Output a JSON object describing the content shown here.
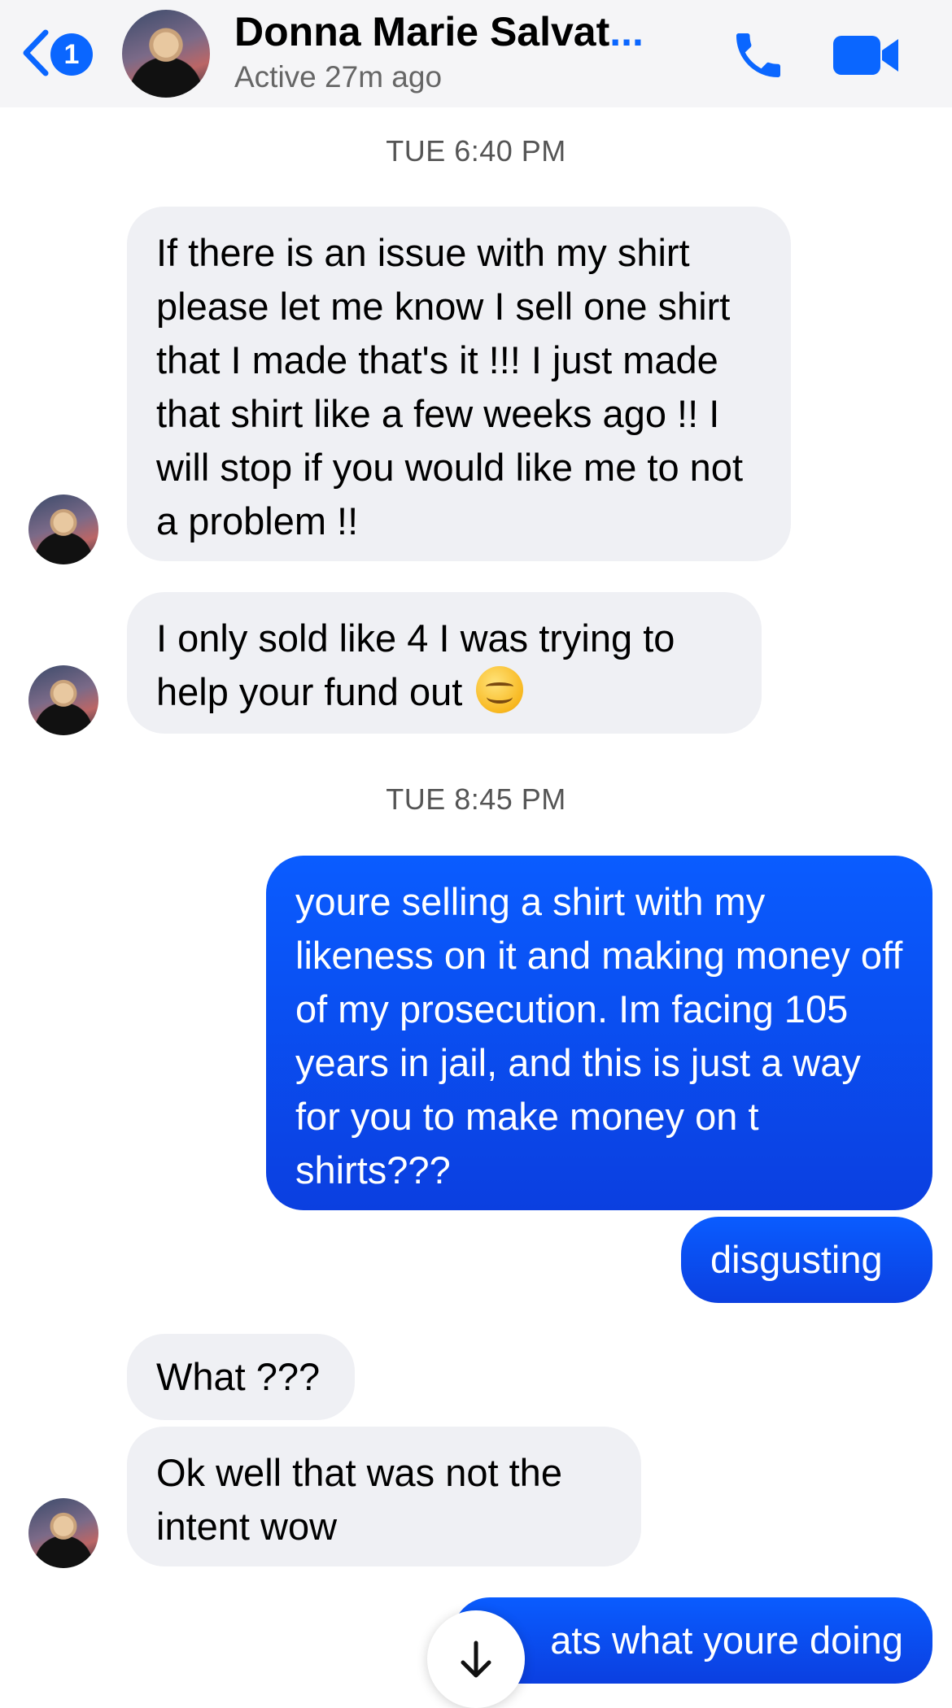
{
  "header": {
    "back_badge": "1",
    "contact_name": "Donna Marie Salvat",
    "name_truncation": "...",
    "status": "Active 27m ago",
    "icons": [
      "back-chevron-icon",
      "phone-icon",
      "video-camera-icon"
    ],
    "accent": "#0a66ff"
  },
  "thread": {
    "stamp1": "TUE 6:40 PM",
    "msg1": "If there is an issue with my shirt please let me know I sell one shirt that I made that's it !!! I just made that shirt like a few weeks ago !! I will stop if you would like me to not a problem !!",
    "msg2": "I only sold like 4 I was trying to help your fund out",
    "msg2_emoji": "smiling-face-emoji",
    "stamp2": "TUE 8:45 PM",
    "msg3": "youre selling a shirt with my likeness on it and making money off of my prosecution. Im facing 105 years in jail, and this is just a way for you to make money on t shirts???",
    "msg4": "disgusting",
    "msg5": "What ???",
    "msg6": "Ok well that was not the intent wow",
    "msg7": "ats what youre doing"
  },
  "colors": {
    "incoming_bubble": "#eff0f4",
    "outgoing_bubble": "#0a5cff"
  }
}
